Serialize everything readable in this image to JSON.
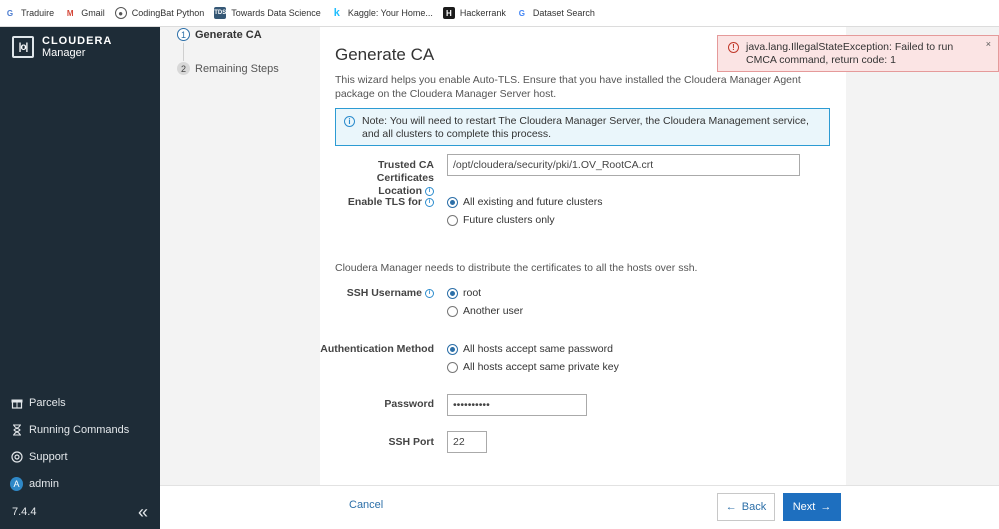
{
  "bookmarks": [
    {
      "label": "Traduire",
      "icon": "translate-icon",
      "color": "#4a7bd0"
    },
    {
      "label": "Gmail",
      "icon": "gmail-icon",
      "color": "#d44638"
    },
    {
      "label": "CodingBat Python",
      "icon": "codingbat-icon",
      "color": "#555555"
    },
    {
      "label": "Towards Data Science",
      "icon": "tds-icon",
      "color": "#355876"
    },
    {
      "label": "Kaggle: Your Home...",
      "icon": "kaggle-icon",
      "color": "#20beff"
    },
    {
      "label": "Hackerrank",
      "icon": "hackerrank-icon",
      "color": "#1b1b1b"
    },
    {
      "label": "Dataset Search",
      "icon": "google-icon",
      "color": "#4285f4"
    }
  ],
  "sidebar": {
    "logo_line1": "CLOUDERA",
    "logo_line2": "Manager",
    "nav": [
      {
        "label": "Parcels",
        "icon": "gift-icon"
      },
      {
        "label": "Running Commands",
        "icon": "hourglass-icon"
      },
      {
        "label": "Support",
        "icon": "lifebuoy-icon"
      },
      {
        "label": "admin",
        "icon": "avatar-icon",
        "avatar_letter": "A"
      }
    ],
    "version": "7.4.4",
    "collapse_glyph": "«"
  },
  "steps": [
    {
      "number": "1",
      "label": "Generate CA",
      "active": true
    },
    {
      "number": "2",
      "label": "Remaining Steps",
      "active": false
    }
  ],
  "main": {
    "title": "Generate CA",
    "intro": "This wizard helps you enable Auto-TLS. Ensure that you have installed the Cloudera Manager Agent package on the Cloudera Manager Server host.",
    "note": "Note: You will need to restart The Cloudera Manager Server, the Cloudera Management service, and all clusters to complete this process.",
    "trusted_ca": {
      "label_line1": "Trusted CA Certificates",
      "label_line2": "Location",
      "value": "/opt/cloudera/security/pki/1.OV_RootCA.crt"
    },
    "enable_tls": {
      "label": "Enable TLS for",
      "options": [
        "All existing and future clusters",
        "Future clusters only"
      ],
      "selected": "All existing and future clusters"
    },
    "distribute_text": "Cloudera Manager needs to distribute the certificates to all the hosts over ssh.",
    "ssh_username": {
      "label": "SSH Username",
      "options": [
        "root",
        "Another user"
      ],
      "selected": "root"
    },
    "auth_method": {
      "label": "Authentication Method",
      "options": [
        "All hosts accept same password",
        "All hosts accept same private key"
      ],
      "selected": "All hosts accept same password"
    },
    "password": {
      "label": "Password",
      "value": "••••••••••"
    },
    "ssh_port": {
      "label": "SSH Port",
      "value": "22"
    }
  },
  "footer": {
    "cancel": "Cancel",
    "back": "Back",
    "next": "Next"
  },
  "toast": {
    "message": "java.lang.IllegalStateException: Failed to run CMCA command, return code: 1",
    "close": "×"
  },
  "colors": {
    "sidebar_bg": "#1e2c37",
    "accent": "#1e6fbf",
    "error_bg": "#fbe4e4",
    "note_bg": "#eaf6fb"
  }
}
